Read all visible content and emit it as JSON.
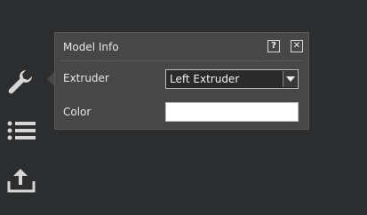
{
  "colors": {
    "background": "#2b2d2f",
    "panel": "#474747",
    "icon": "#d6d6d6",
    "swatch": "#ffffff"
  },
  "toolbar": {
    "items": [
      {
        "icon": "wrench-icon"
      },
      {
        "icon": "list-icon"
      },
      {
        "icon": "upload-icon"
      }
    ]
  },
  "model_info": {
    "title": "Model Info",
    "help_label": "?",
    "close_label": "✕",
    "extruder_label": "Extruder",
    "extruder_value": "Left Extruder",
    "color_label": "Color"
  }
}
